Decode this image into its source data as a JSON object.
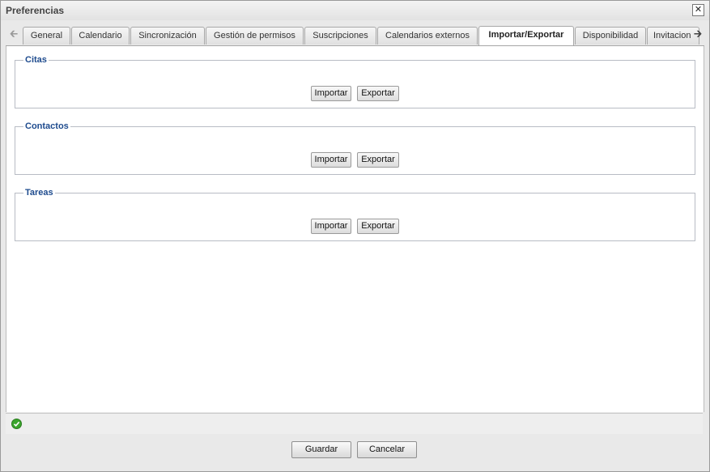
{
  "window": {
    "title": "Preferencias",
    "close_label": "✕"
  },
  "tabs": [
    {
      "label": "General",
      "active": false
    },
    {
      "label": "Calendario",
      "active": false
    },
    {
      "label": "Sincronización",
      "active": false
    },
    {
      "label": "Gestión de permisos",
      "active": false
    },
    {
      "label": "Suscripciones",
      "active": false
    },
    {
      "label": "Calendarios externos",
      "active": false
    },
    {
      "label": "Importar/Exportar",
      "active": true
    },
    {
      "label": "Disponibilidad",
      "active": false
    },
    {
      "label": "Invitacion",
      "active": false
    }
  ],
  "tab_scroll": {
    "left_icon": "arrow-left-icon",
    "right_icon": "arrow-right-icon"
  },
  "sections": [
    {
      "legend": "Citas",
      "import_label": "Importar",
      "export_label": "Exportar"
    },
    {
      "legend": "Contactos",
      "import_label": "Importar",
      "export_label": "Exportar"
    },
    {
      "legend": "Tareas",
      "import_label": "Importar",
      "export_label": "Exportar"
    }
  ],
  "status": {
    "icon": "check-circle-icon",
    "color": "#3aa52c"
  },
  "footer": {
    "save_label": "Guardar",
    "cancel_label": "Cancelar"
  },
  "colors": {
    "legend": "#1e4b8e"
  }
}
